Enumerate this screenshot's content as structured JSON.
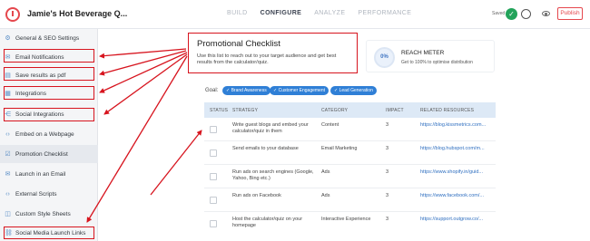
{
  "header": {
    "app_title": "Jamie's Hot Beverage Q...",
    "nav": [
      "BUILD",
      "CONFIGURE",
      "ANALYZE",
      "PERFORMANCE"
    ],
    "active_nav": "CONFIGURE",
    "saved_label": "Saved",
    "publish_label": "Publish"
  },
  "sidebar": {
    "items": [
      {
        "label": "General & SEO Settings",
        "icon": "gear-icon"
      },
      {
        "label": "Email Notifications",
        "icon": "envelope-icon"
      },
      {
        "label": "Save results as pdf",
        "icon": "pdf-icon"
      },
      {
        "label": "Integrations",
        "icon": "plug-icon"
      },
      {
        "label": "Social Integrations",
        "icon": "share-icon"
      },
      {
        "label": "Embed on a Webpage",
        "icon": "code-icon"
      },
      {
        "label": "Promotion Checklist",
        "icon": "checklist-icon"
      },
      {
        "label": "Launch in an Email",
        "icon": "envelope-icon"
      },
      {
        "label": "External Scripts",
        "icon": "code-icon"
      },
      {
        "label": "Custom Style Sheets",
        "icon": "css-icon"
      },
      {
        "label": "Social Media Launch Links",
        "icon": "link-icon"
      }
    ]
  },
  "checklist": {
    "title": "Promotional Checklist",
    "description": "Use this list to reach out to your target audience and get best results from the calculator/quiz."
  },
  "reach_meter": {
    "percent": "0%",
    "title": "REACH METER",
    "subtitle": "Get to 100% to optimise distribution"
  },
  "goals": {
    "label": "Goal:",
    "chips": [
      "Brand Awareness",
      "Customer Engagement",
      "Lead Generation"
    ]
  },
  "table": {
    "headers": [
      "STATUS",
      "STRATEGY",
      "CATEGORY",
      "IMPACT",
      "RELATED RESOURCES"
    ],
    "rows": [
      {
        "strategy": "Write guest blogs and embed your calculator/quiz in them",
        "category": "Content",
        "impact": "3",
        "link": "https://blog.kissmetrics.com..."
      },
      {
        "strategy": "Send emails to your database",
        "category": "Email Marketing",
        "impact": "3",
        "link": "https://blog.hubspot.com/m..."
      },
      {
        "strategy": "Run ads on search engines (Google, Yahoo, Bing etc.)",
        "category": "Ads",
        "impact": "3",
        "link": "https://www.shopify.in/guid..."
      },
      {
        "strategy": "Run ads on Facebook",
        "category": "Ads",
        "impact": "3",
        "link": "https://www.facebook.com/..."
      },
      {
        "strategy": "Host the calculator/quiz on your homepage",
        "category": "Interactive Experience",
        "impact": "3",
        "link": "https://support.outgrow.co/..."
      }
    ]
  },
  "annotation_color": "#d7141e",
  "accent_color": "#2f7fd6"
}
